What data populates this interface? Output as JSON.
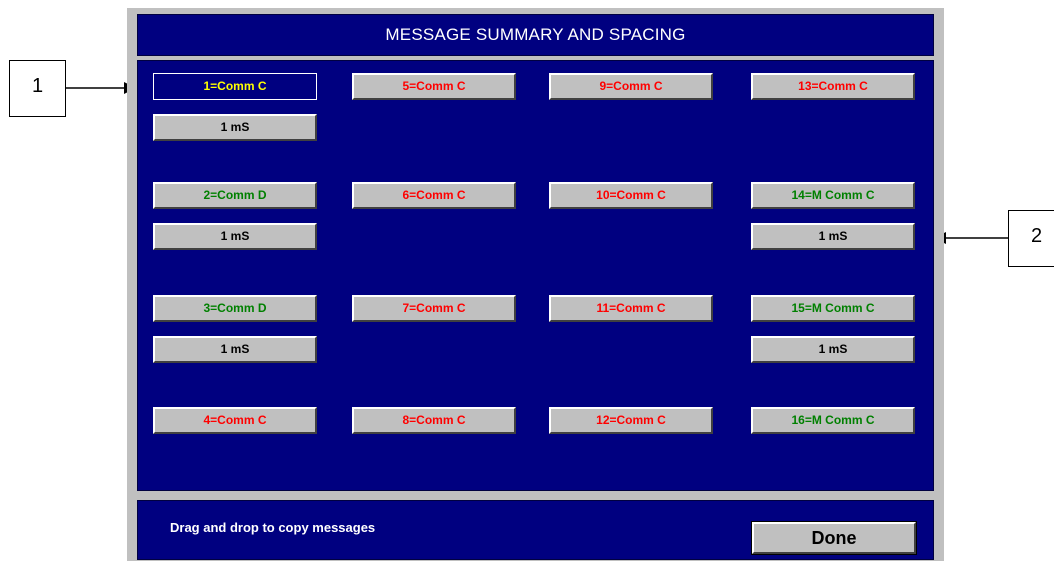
{
  "window": {
    "title": "MESSAGE SUMMARY AND SPACING"
  },
  "messages": [
    {
      "label": "1=Comm C",
      "color": "yellow",
      "selected": true
    },
    {
      "label": "2=Comm D",
      "color": "green"
    },
    {
      "label": "3=Comm D",
      "color": "green"
    },
    {
      "label": "4=Comm C",
      "color": "red"
    },
    {
      "label": "5=Comm C",
      "color": "red"
    },
    {
      "label": "6=Comm C",
      "color": "red"
    },
    {
      "label": "7=Comm C",
      "color": "red"
    },
    {
      "label": "8=Comm C",
      "color": "red"
    },
    {
      "label": "9=Comm C",
      "color": "red"
    },
    {
      "label": "10=Comm C",
      "color": "red"
    },
    {
      "label": "11=Comm C",
      "color": "red"
    },
    {
      "label": "12=Comm C",
      "color": "red"
    },
    {
      "label": "13=Comm C",
      "color": "red"
    },
    {
      "label": "14=M Comm C",
      "color": "green"
    },
    {
      "label": "15=M Comm C",
      "color": "green"
    },
    {
      "label": "16=M Comm C",
      "color": "green"
    }
  ],
  "spacing": [
    {
      "label": "1 mS"
    },
    {
      "label": "1 mS"
    },
    {
      "label": "1 mS"
    },
    {
      "label": "1 mS"
    },
    {
      "label": "1 mS"
    }
  ],
  "footer": {
    "hint": "Drag and drop to copy messages",
    "done_label": "Done"
  },
  "callouts": [
    {
      "label": "1"
    },
    {
      "label": "2"
    }
  ],
  "colors": {
    "panel_bg": "#000080",
    "window_bg": "#c0c0c0",
    "red_text": "#ff0000",
    "green_text": "#008000",
    "selected_text": "#ffff00"
  }
}
